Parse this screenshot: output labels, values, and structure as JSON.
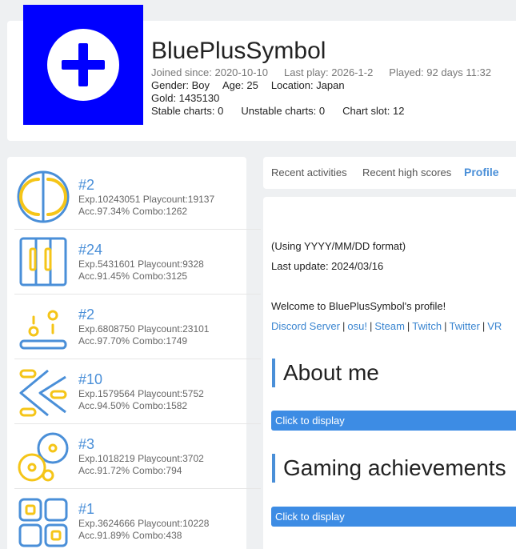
{
  "profile": {
    "username": "BluePlusSymbol",
    "joined": "Joined since: 2020-10-10",
    "last_play": "Last play: 2026-1-2",
    "played": "Played: 92 days 11:32",
    "gender": "Gender: Boy",
    "age": "Age: 25",
    "location": "Location: Japan",
    "gold": "Gold: 1435130",
    "stable_charts": "Stable charts: 0",
    "unstable_charts": "Unstable charts: 0",
    "chart_slot": "Chart slot: 12"
  },
  "games": [
    {
      "icon": "circle-split-icon",
      "rank": "#2",
      "exp": "Exp.10243051 Playcount:19137",
      "acc": "Acc.97.34% Combo:1262"
    },
    {
      "icon": "piano-keys-icon",
      "rank": "#24",
      "exp": "Exp.5431601 Playcount:9328",
      "acc": "Acc.91.45% Combo:3125"
    },
    {
      "icon": "catch-plate-icon",
      "rank": "#2",
      "exp": "Exp.6808750 Playcount:23101",
      "acc": "Acc.97.70% Combo:1749"
    },
    {
      "icon": "chevron-notes-icon",
      "rank": "#10",
      "exp": "Exp.1579564 Playcount:5752",
      "acc": "Acc.94.50% Combo:1582"
    },
    {
      "icon": "discs-icon",
      "rank": "#3",
      "exp": "Exp.1018219 Playcount:3702",
      "acc": "Acc.91.72% Combo:794"
    },
    {
      "icon": "grid-tiles-icon",
      "rank": "#1",
      "exp": "Exp.3624666 Playcount:10228",
      "acc": "Acc.91.89% Combo:438"
    }
  ],
  "tabs": [
    {
      "label": "Recent activities",
      "active": false
    },
    {
      "label": "Recent high scores",
      "active": false
    },
    {
      "label": "Profile",
      "active": true
    }
  ],
  "content": {
    "date_format": "(Using YYYY/MM/DD format)",
    "last_update": "Last update: 2024/03/16",
    "welcome": "Welcome to BluePlusSymbol's profile!",
    "links": [
      "Discord Server",
      "osu!",
      "Steam",
      "Twitch",
      "Twitter",
      "VR"
    ],
    "about_heading": "About me",
    "about_button": "Click to display",
    "achievements_heading": "Gaming achievements",
    "achievements_button": "Click to display"
  },
  "colors": {
    "avatar_bg": "#0000ff",
    "accent_blue": "#4a8fd8",
    "icon_yellow": "#f5c518",
    "button_blue": "#3d8ce4"
  }
}
